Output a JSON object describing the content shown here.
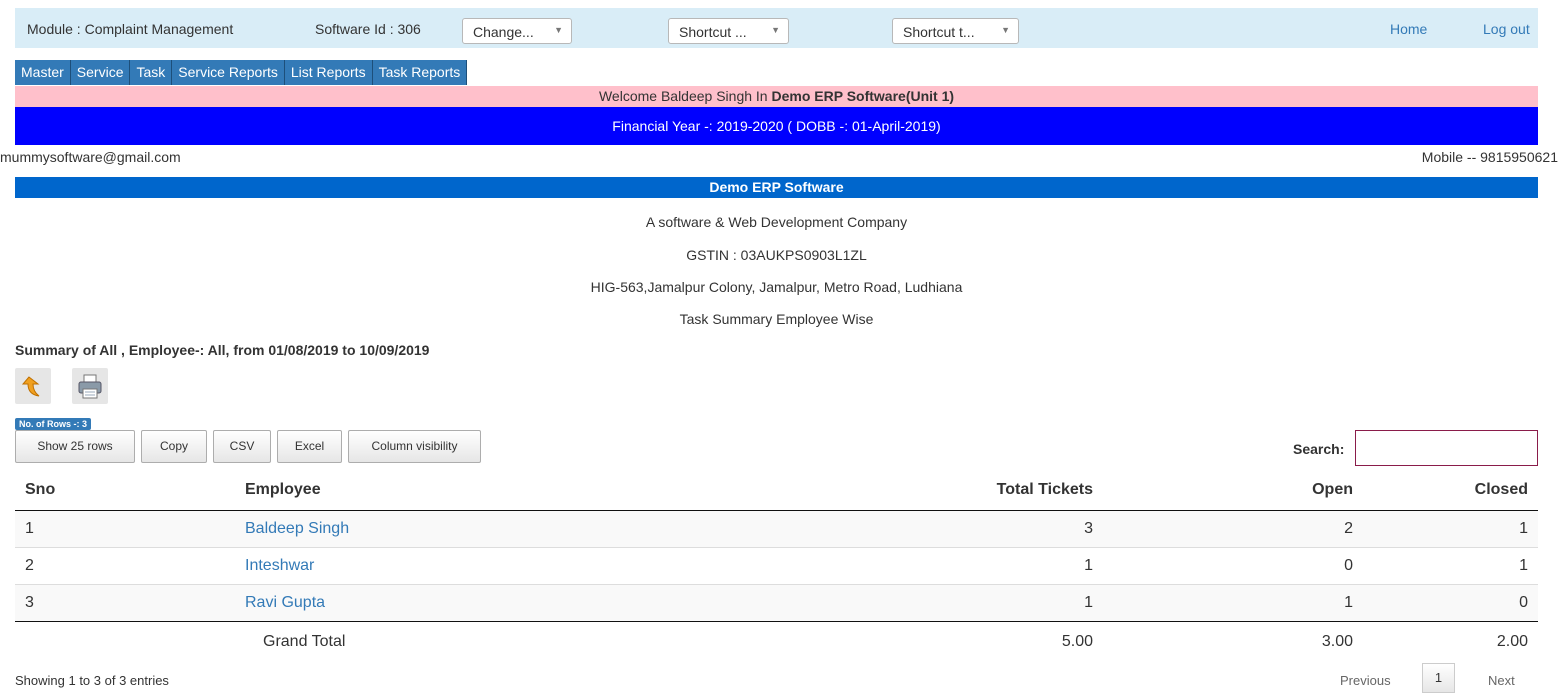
{
  "topbar": {
    "module": "Module : Complaint Management",
    "software_id": "Software Id : 306",
    "change_select": "Change...",
    "shortcut1": "Shortcut ...",
    "shortcut2": "Shortcut t...",
    "home": "Home",
    "logout": "Log out"
  },
  "menu": [
    "Master",
    "Service",
    "Task",
    "Service Reports",
    "List Reports",
    "Task Reports"
  ],
  "welcome": {
    "prefix": "Welcome Baldeep Singh In ",
    "company": "Demo ERP Software(Unit 1)"
  },
  "financial_year": "Financial Year -: 2019-2020 ( DOBB -: 01-April-2019)",
  "contact": {
    "email": "mummysoftware@gmail.com",
    "mobile": "Mobile -- 9815950621"
  },
  "company": {
    "name": "Demo ERP Software",
    "tagline": "A software & Web Development Company",
    "gstin": "GSTIN : 03AUKPS0903L1ZL",
    "address": "HIG-563,Jamalpur Colony, Jamalpur, Metro Road, Ludhiana",
    "report_title": "Task Summary Employee Wise"
  },
  "summary": "Summary of All , Employee-: All, from 01/08/2019 to 10/09/2019",
  "icons": {
    "back": "undo-arrow-icon",
    "print": "printer-icon"
  },
  "rows_badge": "No. of Rows -: 3",
  "buttons": {
    "show_rows": "Show 25 rows",
    "copy": "Copy",
    "csv": "CSV",
    "excel": "Excel",
    "colvis": "Column visibility"
  },
  "search_label": "Search:",
  "table": {
    "headers": {
      "sno": "Sno",
      "employee": "Employee",
      "total": "Total Tickets",
      "open": "Open",
      "closed": "Closed"
    },
    "rows": [
      {
        "sno": "1",
        "employee": "Baldeep Singh",
        "total": "3",
        "open": "2",
        "closed": "1"
      },
      {
        "sno": "2",
        "employee": "Inteshwar",
        "total": "1",
        "open": "0",
        "closed": "1"
      },
      {
        "sno": "3",
        "employee": "Ravi Gupta",
        "total": "1",
        "open": "1",
        "closed": "0"
      }
    ],
    "total": {
      "label": "Grand Total",
      "total": "5.00",
      "open": "3.00",
      "closed": "2.00"
    }
  },
  "footer": {
    "showing": "Showing 1 to 3 of 3 entries",
    "previous": "Previous",
    "page": "1",
    "next": "Next"
  }
}
